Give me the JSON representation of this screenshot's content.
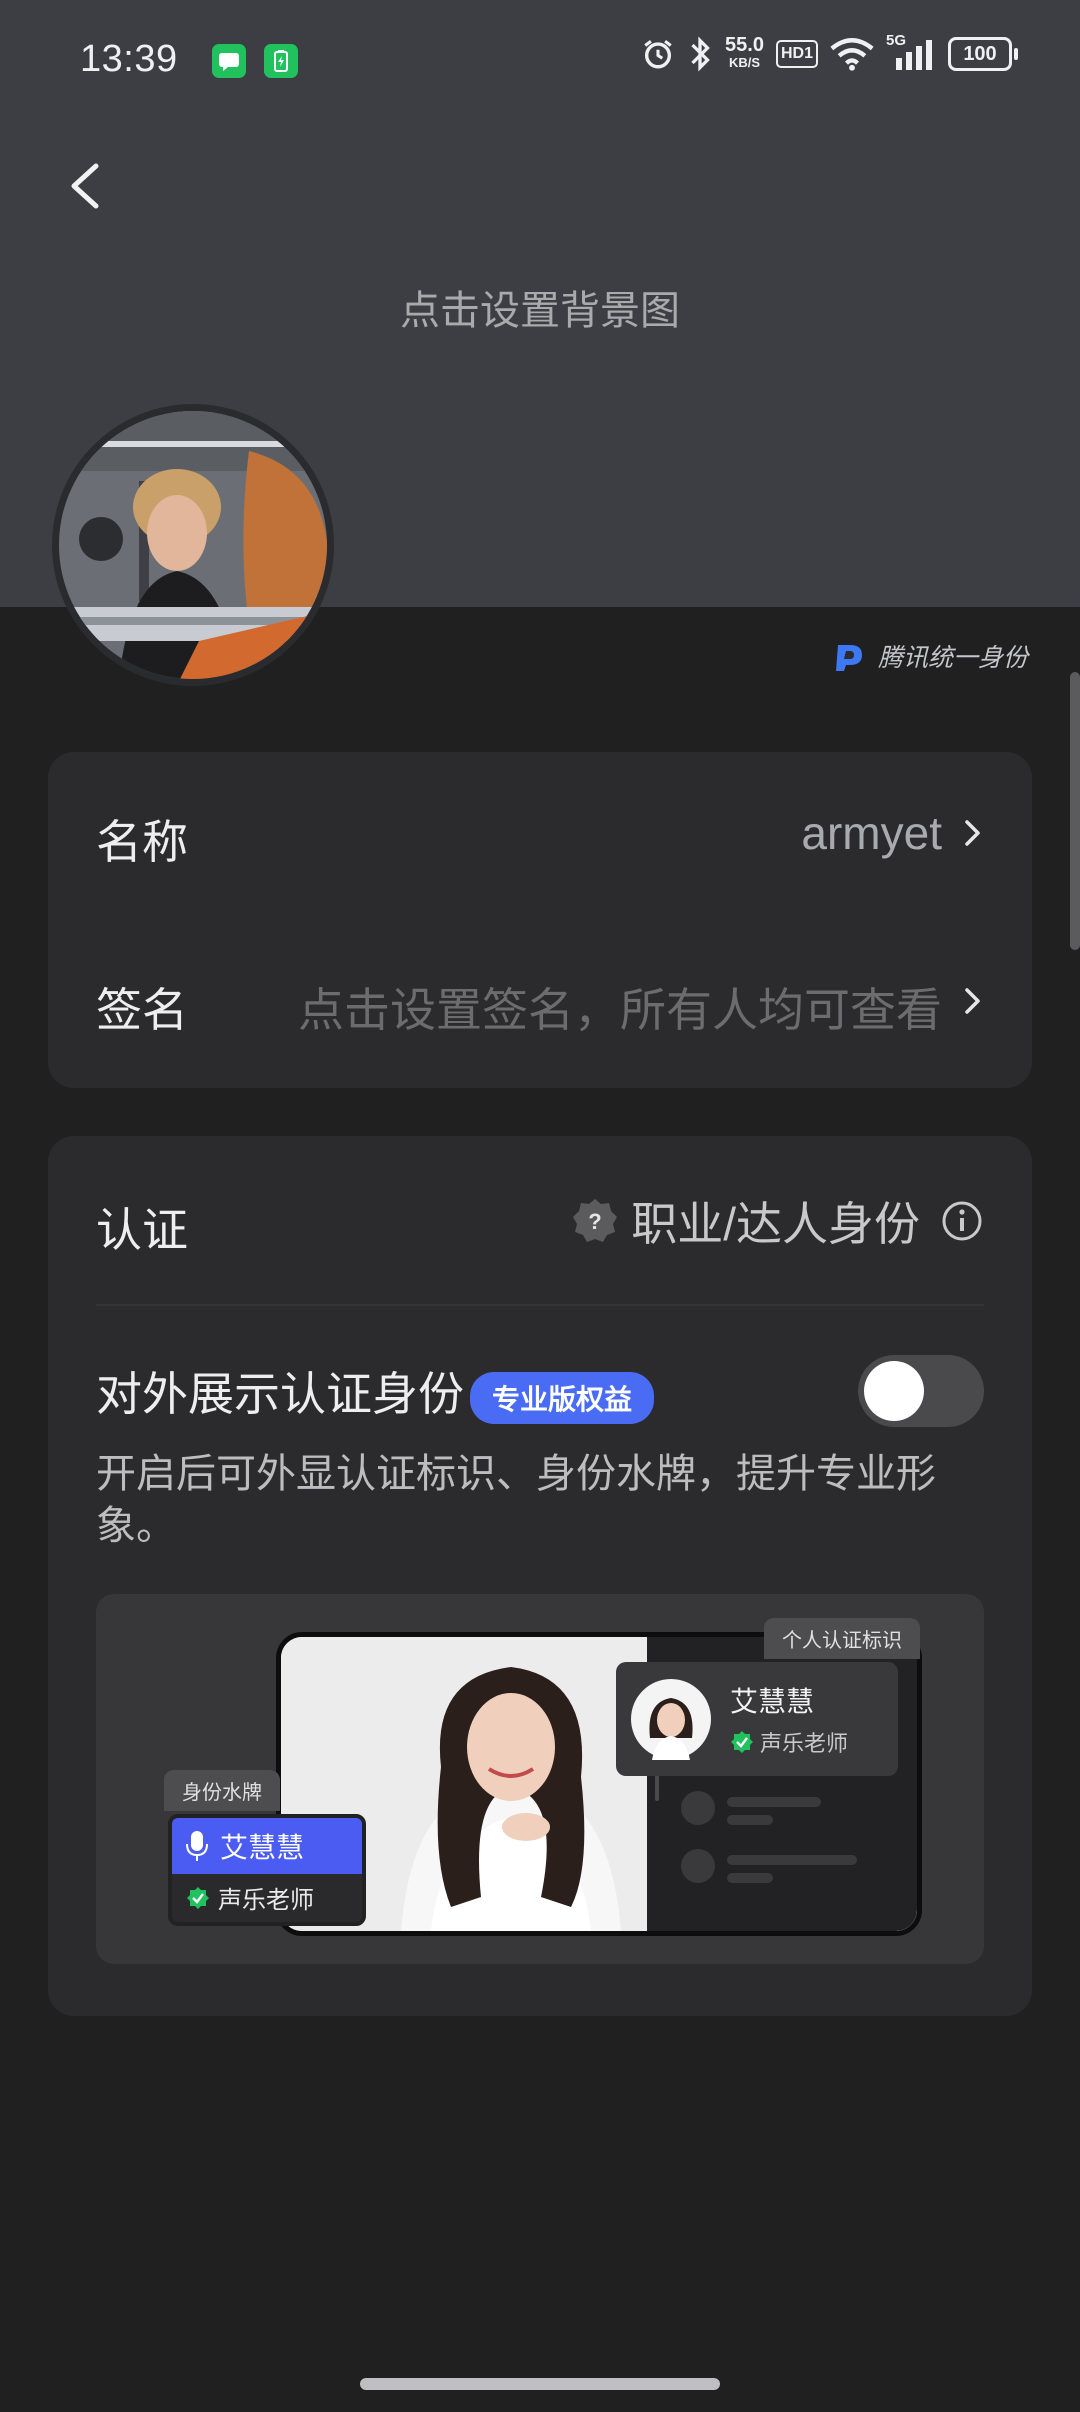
{
  "status_bar": {
    "time": "13:39",
    "speed_value": "55.0",
    "speed_unit": "KB/S",
    "hd": "HD1",
    "network": "5G",
    "battery": "100"
  },
  "header": {
    "background_hint": "点击设置背景图",
    "provider": "腾讯统一身份"
  },
  "profile": {
    "name_label": "名称",
    "name_value": "armyet",
    "signature_label": "签名",
    "signature_placeholder": "点击设置签名，所有人均可查看"
  },
  "certification": {
    "label": "认证",
    "value": "职业/达人身份",
    "toggle_title": "对外展示认证身份",
    "pro_badge": "专业版权益",
    "toggle_on": false,
    "description": "开启后可外显认证标识、身份水牌，提升专业形象。",
    "preview": {
      "tag_personal": "个人认证标识",
      "tag_watermark": "身份水牌",
      "person_name": "艾慧慧",
      "person_title": "声乐老师"
    }
  },
  "colors": {
    "header_bg": "#3c3e43",
    "page_bg": "#202021",
    "card_bg": "#2b2b2d",
    "accent": "#4a6cf5",
    "verified": "#21c25e"
  }
}
